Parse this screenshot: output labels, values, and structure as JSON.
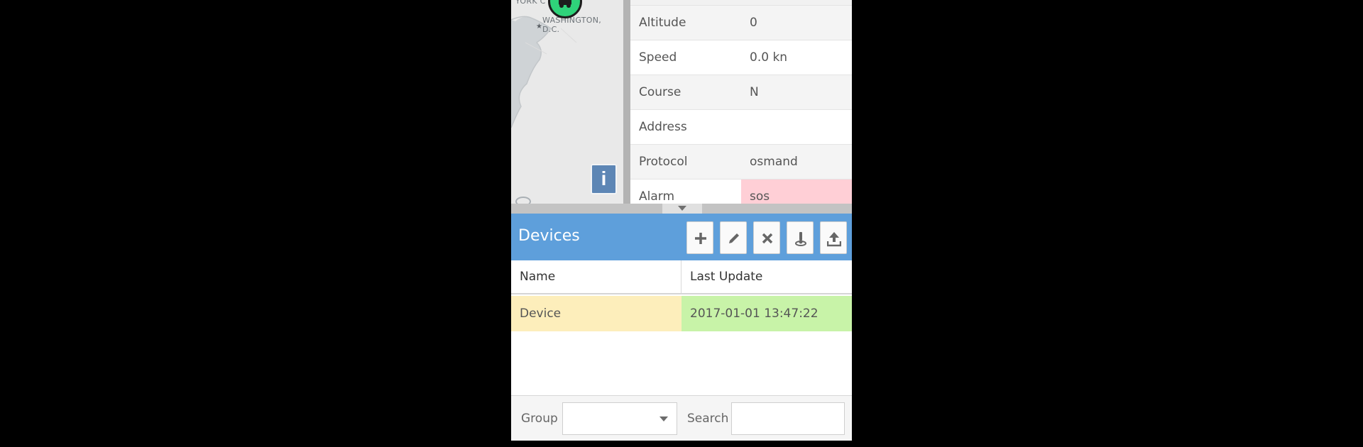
{
  "map": {
    "label_top": "YORK C",
    "label_city": "WASHINGTON,",
    "label_state": "D.C.",
    "info_label": "i",
    "marker_color": "#2fd37a"
  },
  "attributes": [
    {
      "name": "Altitude",
      "value": "0"
    },
    {
      "name": "Speed",
      "value": "0.0 kn"
    },
    {
      "name": "Course",
      "value": "N"
    },
    {
      "name": "Address",
      "value": ""
    },
    {
      "name": "Protocol",
      "value": "osmand"
    },
    {
      "name": "Alarm",
      "value": "sos"
    }
  ],
  "devices": {
    "title": "Devices",
    "header_color": "#5e9fdb",
    "tools": [
      "plus-icon",
      "pencil-icon",
      "close-icon",
      "geofence-link-icon",
      "upload-icon"
    ],
    "columns": [
      "Name",
      "Last Update"
    ],
    "rows": [
      {
        "name": "Device",
        "last_update": "2017-01-01 13:47:22"
      }
    ]
  },
  "footer": {
    "group_label": "Group",
    "group_value": "",
    "search_label": "Search",
    "search_value": ""
  }
}
